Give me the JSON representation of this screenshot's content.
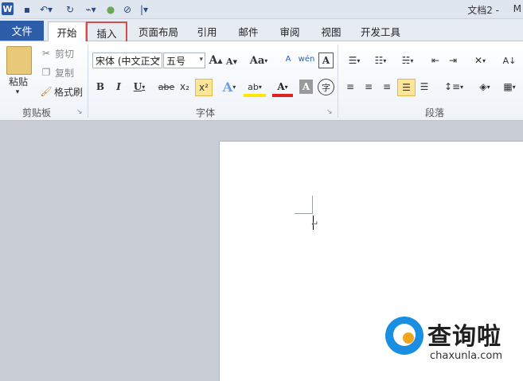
{
  "titlebar": {
    "app_logo": "W",
    "icons": [
      "save-icon",
      "undo-icon",
      "redo-icon",
      "format-painter-icon",
      "color-icon",
      "clear-icon",
      "qat-dropdown-icon"
    ],
    "doc_title": "文档2 -",
    "doc_title_tail": "M"
  },
  "tabs": {
    "file": "文件",
    "items": [
      "开始",
      "插入",
      "页面布局",
      "引用",
      "邮件",
      "审阅",
      "视图",
      "开发工具"
    ],
    "active": "开始",
    "highlighted": "插入",
    "highlight_color": "#d94a4a"
  },
  "ribbon": {
    "clipboard": {
      "label": "剪贴板",
      "paste": "粘贴",
      "cut": "剪切",
      "copy": "复制",
      "format_painter": "格式刷"
    },
    "font": {
      "label": "字体",
      "font_name": "宋体 (中文正文",
      "font_size": "五号",
      "grow": "A",
      "shrink": "A",
      "case": "Aa",
      "phonetic": "wén",
      "clear_format": "A",
      "bold": "B",
      "italic": "I",
      "underline": "U",
      "strike": "abe",
      "subscript": "x₂",
      "superscript": "x²",
      "text_effect": "A",
      "highlight": "ab",
      "font_color": "A",
      "char_shading": "A",
      "enclose": "字"
    },
    "paragraph": {
      "label": "段落"
    }
  },
  "watermark": {
    "brand": "查询啦",
    "url": "chaxunla.com",
    "logo_color": "#1a8ee0",
    "accent_color": "#f2a51a"
  }
}
